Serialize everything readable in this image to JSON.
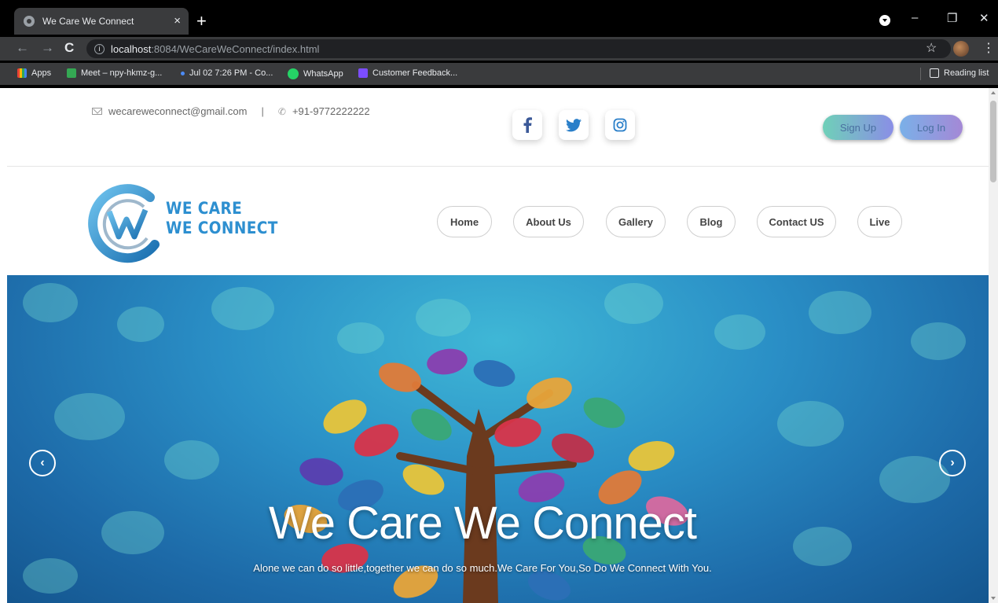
{
  "browser": {
    "tab_title": "We Care We Connect",
    "tab_close": "×",
    "new_tab": "+",
    "url_host": "localhost",
    "url_rest": ":8084/WeCareWeConnect/index.html",
    "bookmarks": [
      {
        "label": "Apps",
        "color": "#e8a33a"
      },
      {
        "label": "Meet – npy-hkmz-g...",
        "color": "#34a853"
      },
      {
        "label": "Jul 02 7:26 PM - Co...",
        "color": "#4c8bf5"
      },
      {
        "label": "WhatsApp",
        "color": "#25d366"
      },
      {
        "label": "Customer Feedback...",
        "color": "#7c4dff"
      }
    ],
    "reading_list": "Reading list",
    "window_controls": [
      "–",
      "❐",
      "✕"
    ]
  },
  "topbar": {
    "email": "wecareweconnect@gmail.com",
    "separator": "|",
    "phone": "+91-9772222222",
    "social": [
      "facebook-icon",
      "twitter-icon",
      "instagram-icon"
    ],
    "signup_label": "Sign Up",
    "login_label": "Log In"
  },
  "brand": {
    "line1": "WE CARE",
    "line2": "WE CONNECT",
    "color": "#2d8fd0"
  },
  "nav": {
    "items": [
      "Home",
      "About Us",
      "Gallery",
      "Blog",
      "Contact US",
      "Live"
    ]
  },
  "hero": {
    "title": "We Care We Connect",
    "subtitle": "Alone we can do so little,together we can do so much.We Care For You,So Do We Connect With You.",
    "prev": "‹",
    "next": "›"
  }
}
